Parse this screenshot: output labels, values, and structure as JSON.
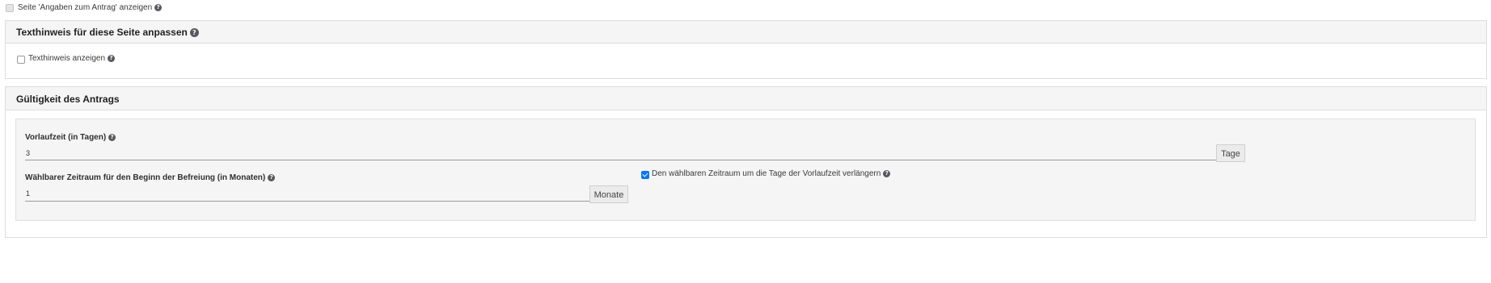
{
  "top_option": {
    "label": "Seite 'Angaben zum Antrag' anzeigen",
    "checked": false,
    "disabled": true
  },
  "help_glyph": "?",
  "texthinweis_panel": {
    "title": "Texthinweis für diese Seite anpassen",
    "show_text_label": "Texthinweis anzeigen",
    "show_text_checked": false
  },
  "validity_panel": {
    "title": "Gültigkeit des Antrags",
    "lead_time": {
      "label": "Vorlaufzeit (in Tagen)",
      "value": "3",
      "unit": "Tage"
    },
    "period": {
      "label": "Wählbarer Zeitraum für den Beginn der Befreiung (in Monaten)",
      "value": "1",
      "unit": "Monate"
    },
    "extend_option": {
      "label": "Den wählbaren Zeitraum um die Tage der Vorlaufzeit verlängern",
      "checked": true
    }
  },
  "colors": {
    "panel_header_bg": "#f5f5f5",
    "checkbox_checked": "#0075ff",
    "help_icon": "#555a60"
  }
}
